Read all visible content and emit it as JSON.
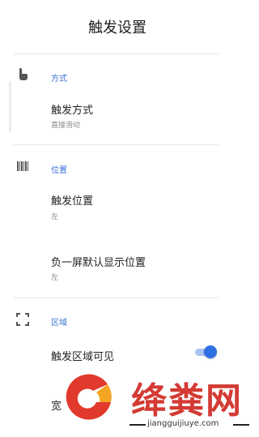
{
  "header": {
    "title": "触发设置"
  },
  "sections": {
    "mode": {
      "label": "方式",
      "icon": "touch-gesture-icon",
      "items": [
        {
          "title": "触发方式",
          "summary": "直接滑动"
        }
      ]
    },
    "position": {
      "label": "位置",
      "icon": "barcode-icon",
      "items": [
        {
          "title": "触发位置",
          "summary": "左"
        },
        {
          "title": "负一屏默认显示位置",
          "summary": "左"
        }
      ]
    },
    "area": {
      "label": "区域",
      "icon": "fullscreen-corners-icon",
      "items": [
        {
          "title": "触发区域可见",
          "toggle_on": true
        },
        {
          "title": "宽"
        }
      ]
    }
  },
  "colors": {
    "accent": "#2f6fe4",
    "section_label": "#3a6fd6",
    "watermark": "#d33a33"
  },
  "watermark": {
    "text": "绛粪网",
    "url": "jiangguijiuye.com"
  }
}
